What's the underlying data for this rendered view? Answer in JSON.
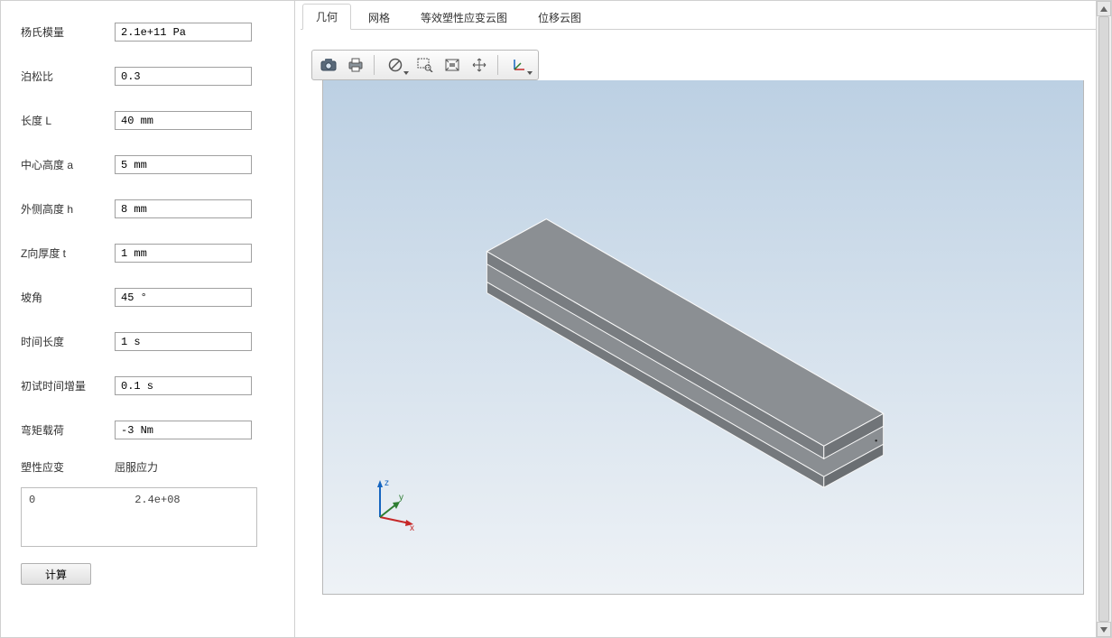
{
  "sidebar": {
    "fields": [
      {
        "label": "杨氏模量",
        "value": "2.1e+11 Pa"
      },
      {
        "label": "泊松比",
        "value": "0.3"
      },
      {
        "label": "长度 L",
        "value": "40 mm"
      },
      {
        "label": "中心高度 a",
        "value": "5 mm"
      },
      {
        "label": "外侧高度 h",
        "value": "8 mm"
      },
      {
        "label": "Z向厚度 t",
        "value": "1 mm"
      },
      {
        "label": "坡角",
        "value": "45 °"
      },
      {
        "label": "时间长度",
        "value": "1 s"
      },
      {
        "label": "初试时间增量",
        "value": "0.1 s"
      },
      {
        "label": "弯矩载荷",
        "value": "-3 Nm"
      }
    ],
    "table_headers": {
      "col1": "塑性应变",
      "col2": "屈服应力"
    },
    "table_row": {
      "col1": "0",
      "col2": "2.4e+08"
    },
    "compute_label": "计算"
  },
  "tabs": [
    {
      "label": "几何",
      "active": true
    },
    {
      "label": "网格",
      "active": false
    },
    {
      "label": "等效塑性应变云图",
      "active": false
    },
    {
      "label": "位移云图",
      "active": false
    }
  ],
  "toolbar_icons": [
    "camera-icon",
    "print-icon",
    "sep",
    "clear-dropdown-icon",
    "zoom-window-icon",
    "fit-all-icon",
    "pan-icon",
    "sep",
    "axes-dropdown-icon"
  ],
  "triad": {
    "x": "x",
    "y": "y",
    "z": "z"
  }
}
